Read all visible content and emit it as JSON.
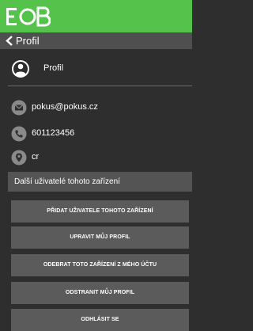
{
  "brand": {
    "logo_icon": "eob-logo-icon",
    "color": "#55c24c"
  },
  "header": {
    "title": "Profil",
    "back_icon": "chevron-left-icon"
  },
  "profile": {
    "name": "Profil",
    "avatar_icon": "user-circle-icon"
  },
  "contact": {
    "email": "pokus@pokus.cz",
    "email_icon": "envelope-icon",
    "phone": "601123456",
    "phone_icon": "phone-icon",
    "location": "cr",
    "location_icon": "location-pin-icon"
  },
  "other_users": {
    "label": "Další uživatelé tohoto zařízení"
  },
  "buttons": {
    "add_user": "PŘIDAT UŽIVATELE TOHOTO ZAŘÍZENÍ",
    "edit_profile": "UPRAVIT MŮJ PROFIL",
    "remove_device": "ODEBRAT TOTO ZAŘÍZENÍ Z MÉHO ÚČTU",
    "delete_profile": "ODSTRANIT MŮJ PROFIL",
    "logout": "ODHLÁSIT SE"
  },
  "colors": {
    "background": "#2e2e2e",
    "title_bar": "#4f4f4f",
    "button": "#5b5b5b",
    "section_bar": "#545454",
    "icon_gray": "#8a8a8a"
  }
}
